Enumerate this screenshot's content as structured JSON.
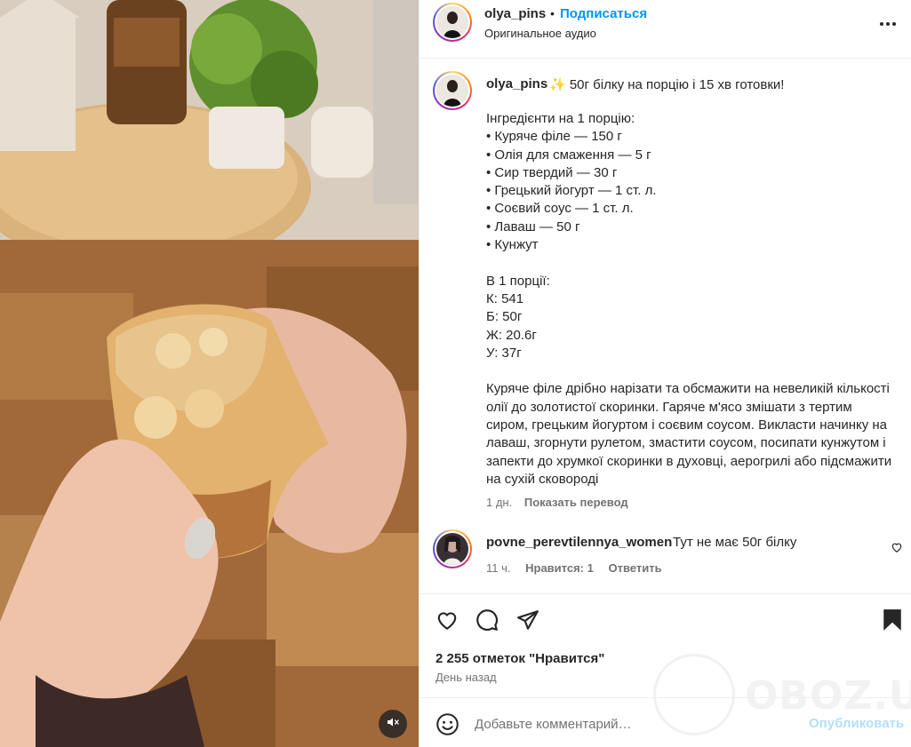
{
  "post": {
    "username": "olya_pins",
    "separator": "•",
    "follow_label": "Подписаться",
    "audio": "Оригинальное аудио"
  },
  "caption": {
    "username": "olya_pins",
    "headline": "✨ 50г білку на порцію і 15 хв готовки!",
    "body": "Інгредієнти на 1 порцію:\n• Куряче філе — 150 г\n• Олія для смаження — 5 г\n• Сир твердий — 30 г\n• Грецький йогурт — 1 ст. л.\n• Соєвий соус — 1 ст. л.\n• Лаваш — 50 г\n• Кунжут\n\nВ 1 порції:\nК: 541\nБ: 50г\nЖ: 20.6г\nУ: 37г\n\nКуряче філе дрібно нарізати та обсмажити на невеликій кількості олії до золотистої скоринки. Гаряче м'ясо змішати з тертим сиром, грецьким йогуртом і соєвим соусом. Викласти начинку на лаваш, згорнути рулетом, змастити соусом, посипати кунжутом і запекти до хрумкої скоринки в духовці, аерогрилі або підсмажити на сухій сковороді",
    "age": "1 дн.",
    "translate_label": "Показать перевод"
  },
  "comment": {
    "username": "povne_perevtilennya_women",
    "text": "Тут не має 50г білку",
    "age": "11 ч.",
    "likes": "Нравится: 1",
    "reply_label": "Ответить"
  },
  "likes_text": "2 255 отметок \"Нравится\"",
  "time_text": "День назад",
  "comment_input": {
    "placeholder": "Добавьте комментарий…",
    "publish_label": "Опубликовать"
  },
  "watermark": "OBOZ.UA",
  "icons": {
    "more": "more-horizontal-icon",
    "like": "heart-icon",
    "comment": "comment-bubble-icon",
    "share": "paper-plane-icon",
    "save": "bookmark-icon",
    "emoji": "smiley-icon",
    "mute": "speaker-muted-icon"
  },
  "colors": {
    "link_blue": "#0095f6",
    "publish_disabled": "#b2dffc",
    "secondary_text": "#737373"
  }
}
